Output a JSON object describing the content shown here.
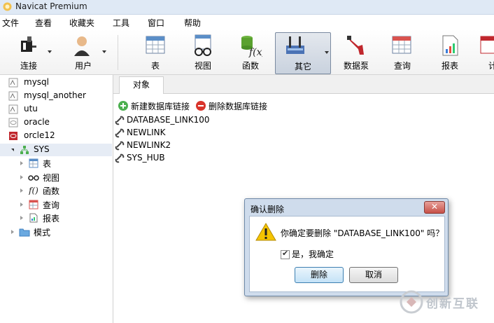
{
  "app": {
    "title": "Navicat Premium"
  },
  "menu": [
    "文件",
    "查看",
    "收藏夹",
    "工具",
    "窗口",
    "帮助"
  ],
  "toolbar": {
    "connect": "连接",
    "user": "用户",
    "table": "表",
    "view": "视图",
    "function": "函数",
    "other": "其它",
    "datapump": "数据泵",
    "query": "查询",
    "report": "报表",
    "truncated": "计"
  },
  "sidebar": {
    "connections": [
      "mysql",
      "mysql_another",
      "utu",
      "oracle",
      "orcle12"
    ],
    "schema": "SYS",
    "children": [
      "表",
      "视图",
      "函数",
      "查询",
      "报表"
    ],
    "mode": "模式"
  },
  "main": {
    "tab": "对象",
    "new_link": "新建数据库链接",
    "delete_link": "删除数据库链接",
    "objects": [
      "DATABASE_LINK100",
      "NEWLINK",
      "NEWLINK2",
      "SYS_HUB"
    ]
  },
  "dialog": {
    "title": "确认删除",
    "close": "✕",
    "message": "你确定要删除 \"DATABASE_LINK100\" 吗？",
    "checkbox_label": "是，我确定",
    "checkbox_checked": true,
    "delete": "删除",
    "cancel": "取消"
  },
  "watermark": {
    "text": "创新互联"
  },
  "colors": {
    "accent": "#cfdcec",
    "oracle_red": "#c0272d",
    "titlebar": "#dfe9f5"
  }
}
